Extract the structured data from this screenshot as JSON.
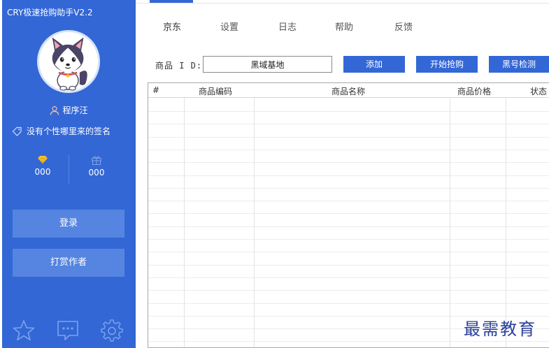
{
  "app": {
    "title": "CRY极速抢购助手V2.2"
  },
  "sidebar": {
    "username": "程序汪",
    "signature": "没有个性哪里来的签名",
    "stats": [
      {
        "icon": "diamond-icon",
        "value": "000"
      },
      {
        "icon": "gift-icon",
        "value": "000"
      }
    ],
    "login_label": "登录",
    "tip_label": "打赏作者",
    "bottom_icons": [
      "star-icon",
      "chat-icon",
      "gear-icon"
    ]
  },
  "tabs": [
    {
      "label": "京东",
      "active": true
    },
    {
      "label": "设置",
      "active": false
    },
    {
      "label": "日志",
      "active": false
    },
    {
      "label": "帮助",
      "active": false
    },
    {
      "label": "反馈",
      "active": false
    }
  ],
  "toolbar": {
    "product_id_label": "商品 I D:",
    "product_id_value": "黑域基地",
    "add_label": "添加",
    "start_label": "开始抢购",
    "blacklist_label": "黑号检测"
  },
  "table": {
    "columns": [
      "#",
      "商品编码",
      "商品名称",
      "商品价格",
      "状态"
    ],
    "rows": []
  },
  "watermark": "最需教育",
  "colors": {
    "accent": "#3367d6",
    "sidebar_button": "#5585e0",
    "watermark": "#2a3f9b"
  }
}
